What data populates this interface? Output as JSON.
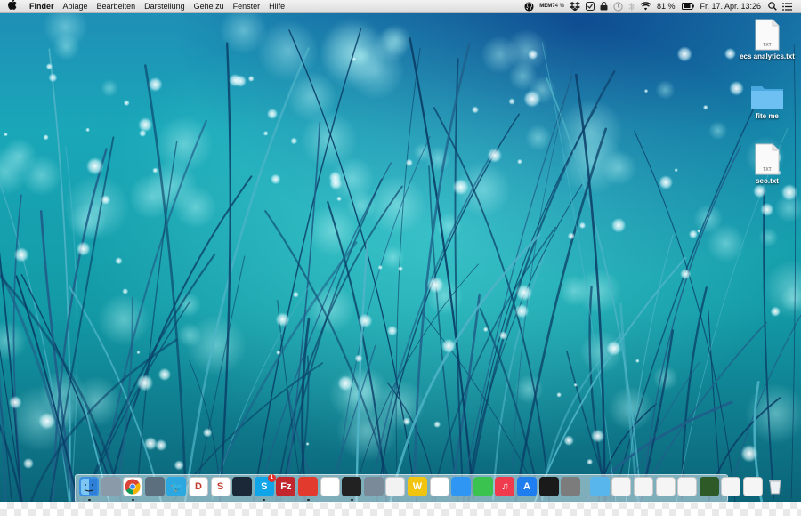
{
  "menubar": {
    "app_name": "Finder",
    "items": [
      "Ablage",
      "Bearbeiten",
      "Darstellung",
      "Gehe zu",
      "Fenster",
      "Hilfe"
    ],
    "memory_label": "MEM",
    "memory_value": "74 %",
    "battery": "81 %",
    "clock": "Fr. 17. Apr.  13:26"
  },
  "desktop": {
    "icons": [
      {
        "name": "ecs analytics.txt",
        "type": "txt",
        "badge": "TXT"
      },
      {
        "name": "fite me",
        "type": "folder"
      },
      {
        "name": "seo.txt",
        "type": "txt",
        "badge": "TXT"
      }
    ]
  },
  "dock": {
    "apps": [
      {
        "name": "finder",
        "color": "#3a8fe0"
      },
      {
        "name": "launchpad",
        "color": "#8a9aa8"
      },
      {
        "name": "chrome",
        "color": "#ffffff"
      },
      {
        "name": "preview",
        "color": "#5c6f7e"
      },
      {
        "name": "twitter",
        "color": "#2ca7e0",
        "glyph": "🐦"
      },
      {
        "name": "todoist",
        "color": "#ffffff",
        "glyph": "D"
      },
      {
        "name": "scrivener",
        "color": "#ffffff",
        "glyph": "S"
      },
      {
        "name": "steam",
        "color": "#1b2838"
      },
      {
        "name": "skype",
        "color": "#10a4e8",
        "glyph": "S",
        "badge": "1"
      },
      {
        "name": "filezilla",
        "color": "#c1272d",
        "glyph": "Fz"
      },
      {
        "name": "pdf-app",
        "color": "#e23b2e"
      },
      {
        "name": "teamviewer",
        "color": "#ffffff"
      },
      {
        "name": "terminal",
        "color": "#222222"
      },
      {
        "name": "pencil-app",
        "color": "#7a8a99"
      },
      {
        "name": "presentation-app",
        "color": "#f2f2f2"
      },
      {
        "name": "dictionary-app",
        "color": "#f1c40f",
        "glyph": "W"
      },
      {
        "name": "photos",
        "color": "#ffffff"
      },
      {
        "name": "messages",
        "color": "#2f96f3"
      },
      {
        "name": "facetime",
        "color": "#3ac34f"
      },
      {
        "name": "music",
        "color": "#f03b4e",
        "glyph": "♫"
      },
      {
        "name": "app-store",
        "color": "#1e7ef0",
        "glyph": "A"
      },
      {
        "name": "activity-monitor",
        "color": "#1a1a1a"
      },
      {
        "name": "system-preferences",
        "color": "#7c7c7c"
      }
    ],
    "stacks": [
      {
        "name": "downloads-folder",
        "color": "#58b6ec"
      },
      {
        "name": "doc-stack-1",
        "color": "#f5f5f5"
      },
      {
        "name": "doc-stack-2",
        "color": "#f5f5f5"
      },
      {
        "name": "doc-stack-3",
        "color": "#f5f5f5"
      },
      {
        "name": "doc-stack-4",
        "color": "#f5f5f5"
      },
      {
        "name": "doc-stack-5",
        "color": "#2d5a27"
      },
      {
        "name": "doc-stack-6",
        "color": "#f5f5f5"
      },
      {
        "name": "doc-stack-7",
        "color": "#f5f5f5"
      },
      {
        "name": "trash",
        "color": "#d8dde2"
      }
    ],
    "running": [
      "finder",
      "chrome",
      "skype",
      "pdf-app",
      "terminal"
    ]
  }
}
